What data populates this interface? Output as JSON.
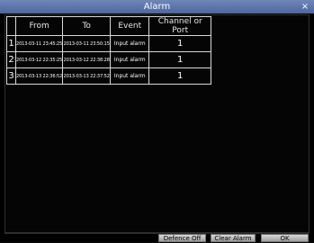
{
  "window": {
    "title": "Alarm",
    "close_label": "×"
  },
  "table": {
    "headers": {
      "from": "From",
      "to": "To",
      "event": "Event",
      "channel": "Channel  or  Port"
    },
    "rows": [
      {
        "index": "1",
        "from": "2013-03-11  23:45:25",
        "to": "2013-03-11  23:50:15",
        "event": "Input alarm",
        "channel": "1"
      },
      {
        "index": "2",
        "from": "2013-03-12  22:35:25",
        "to": "2013-03-12  22:38:28",
        "event": "Input alarm",
        "channel": "1"
      },
      {
        "index": "3",
        "from": "2013-03-13  22:36:52",
        "to": "2013-03-13  22:37:52",
        "event": "Input alarm",
        "channel": "1"
      }
    ]
  },
  "buttons": {
    "defence_off": "Defence  Off",
    "clear_alarm": "Clear  Alarm",
    "ok": "OK"
  },
  "colors": {
    "titlebar": "#5a72a8",
    "background": "#000000",
    "grid_line": "#d8d8d8"
  }
}
